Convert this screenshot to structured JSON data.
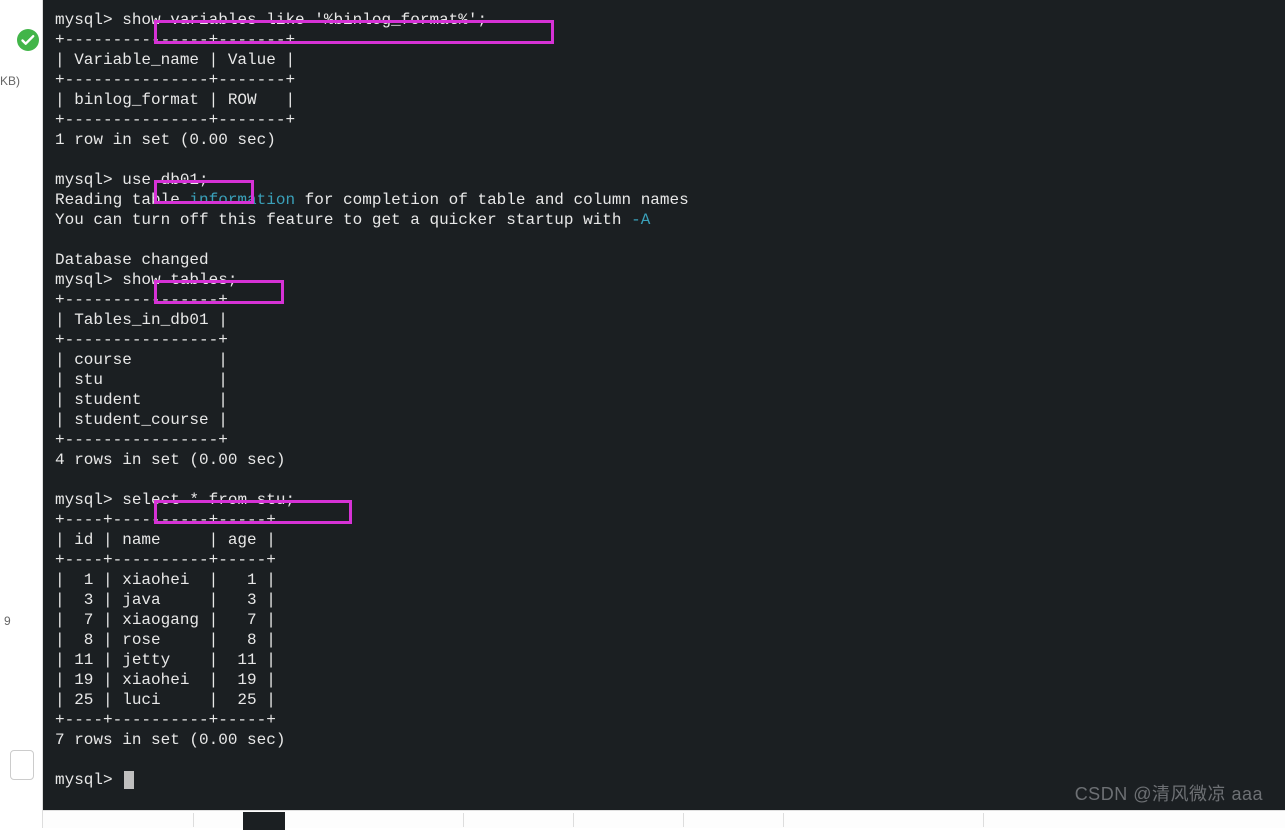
{
  "left_panel": {
    "kb_label": "KB)",
    "side_number": "9"
  },
  "prompts": {
    "mysql": "mysql> "
  },
  "commands": {
    "cmd1": "show variables like '%binlog_format%';",
    "cmd2": "use db01;",
    "cmd3": "show tables;",
    "cmd4": "select * from stu;"
  },
  "texts": {
    "var_border": "+---------------+-------+",
    "var_header": "| Variable_name | Value |",
    "var_row": "| binlog_format | ROW   |",
    "one_row": "1 row in set (0.00 sec)",
    "reading_pre": "Reading table ",
    "information": "information",
    "reading_post": " for completion of table and column names",
    "turnoff_pre": "You can turn off this feature to get a quicker startup with ",
    "flag_a": "-A",
    "db_changed": "Database changed",
    "tables_border": "+----------------+",
    "tables_header": "| Tables_in_db01 |",
    "t1": "| course         |",
    "t2": "| stu            |",
    "t3": "| student        |",
    "t4": "| student_course |",
    "four_rows": "4 rows in set (0.00 sec)",
    "stu_border": "+----+----------+-----+",
    "stu_header": "| id | name     | age |",
    "r1": "|  1 | xiaohei  |   1 |",
    "r2": "|  3 | java     |   3 |",
    "r3": "|  7 | xiaogang |   7 |",
    "r4": "|  8 | rose     |   8 |",
    "r5": "| 11 | jetty    |  11 |",
    "r6": "| 19 | xiaohei  |  19 |",
    "r7": "| 25 | luci     |  25 |",
    "seven_rows": "7 rows in set (0.00 sec)"
  },
  "watermark": "CSDN @清风微凉 aaa"
}
